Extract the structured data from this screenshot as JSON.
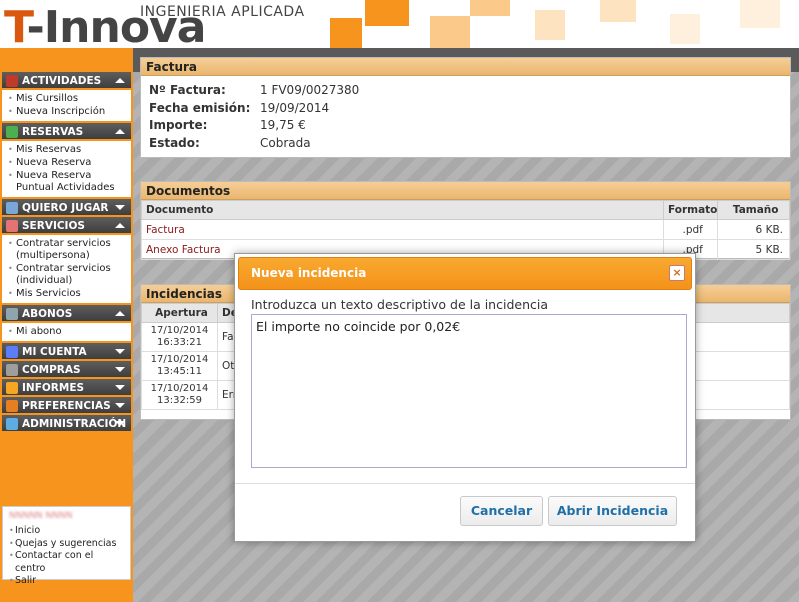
{
  "header": {
    "logo_text_a": "T",
    "logo_text_b": "-Innova",
    "tagline": "INGENIERIA APLICADA",
    "accent": "#f7941d"
  },
  "sidebar": {
    "sections": [
      {
        "label": "ACTIVIDADES",
        "icon": "calendar-icon",
        "expanded": true,
        "items": [
          "Mis Cursillos",
          "Nueva Inscripción"
        ]
      },
      {
        "label": "RESERVAS",
        "icon": "grid-icon",
        "expanded": true,
        "items": [
          "Mis Reservas",
          "Nueva Reserva",
          "Nueva Reserva Puntual Actividades"
        ]
      },
      {
        "label": "QUIERO JUGAR",
        "icon": "search-icon",
        "expanded": false,
        "items": []
      },
      {
        "label": "SERVICIOS",
        "icon": "services-icon",
        "expanded": true,
        "items": [
          "Contratar servicios (multipersona)",
          "Contratar servicios (individual)",
          "Mis Servicios"
        ]
      },
      {
        "label": "ABONOS",
        "icon": "ticket-icon",
        "expanded": true,
        "items": [
          "Mi abono"
        ]
      },
      {
        "label": "MI CUENTA",
        "icon": "user-icon",
        "expanded": false,
        "items": []
      },
      {
        "label": "COMPRAS",
        "icon": "cart-icon",
        "expanded": false,
        "items": []
      },
      {
        "label": "INFORMES",
        "icon": "chart-icon",
        "expanded": false,
        "items": []
      },
      {
        "label": "PREFERENCIAS",
        "icon": "tools-icon",
        "expanded": false,
        "items": []
      },
      {
        "label": "ADMINISTRACIÓN",
        "icon": "admin-icon",
        "expanded": false,
        "items": []
      }
    ],
    "user_box": {
      "name_blurred": "NNNNN NNNN",
      "links": [
        "Inicio",
        "Quejas y sugerencias",
        "Contactar con el centro",
        "Salir"
      ]
    }
  },
  "factura": {
    "title": "Factura",
    "rows": [
      {
        "label": "Nº Factura:",
        "value": "1 FV09/0027380"
      },
      {
        "label": "Fecha emisión:",
        "value": "19/09/2014"
      },
      {
        "label": "Importe:",
        "value": "19,75 €"
      },
      {
        "label": "Estado:",
        "value": "Cobrada"
      }
    ]
  },
  "documentos": {
    "title": "Documentos",
    "columns": [
      "Documento",
      "Formato",
      "Tamaño"
    ],
    "rows": [
      {
        "doc": "Factura",
        "format": ".pdf",
        "size": "6 KB."
      },
      {
        "doc": "Anexo Factura",
        "format": ".pdf",
        "size": "5 KB."
      }
    ]
  },
  "incidencias": {
    "title": "Incidencias",
    "columns": [
      "Apertura",
      "De"
    ],
    "rows": [
      {
        "date": "17/10/2014",
        "time": "16:33:21",
        "desc": "Fa"
      },
      {
        "date": "17/10/2014",
        "time": "13:45:11",
        "desc": "Ot"
      },
      {
        "date": "17/10/2014",
        "time": "13:32:59",
        "desc": "Err"
      }
    ]
  },
  "dialog": {
    "title": "Nueva incidencia",
    "close_label": "×",
    "prompt": "Introduzca un texto descriptivo de la incidencia",
    "text_value": "El importe no coincide por 0,02€",
    "cancel_label": "Cancelar",
    "open_label": "Abrir Incidencia"
  }
}
